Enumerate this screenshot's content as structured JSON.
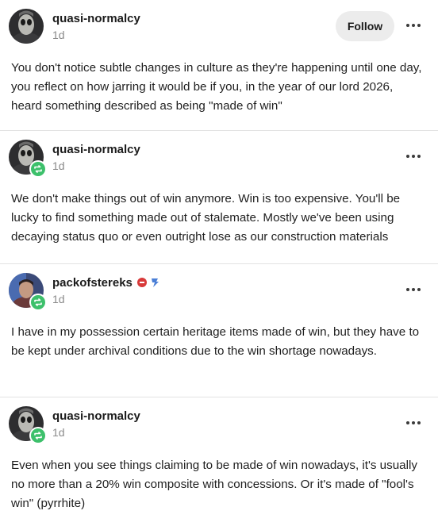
{
  "posts": [
    {
      "username": "quasi-normalcy",
      "timestamp": "1d",
      "follow_label": "Follow",
      "text": "You don't notice subtle changes in culture as they're happening until one day, you reflect on how jarring it would be if you, in the year of our lord 2026, heard something described as being \"made of win\""
    },
    {
      "username": "quasi-normalcy",
      "timestamp": "1d",
      "text": "We don't make things out of win anymore. Win is too expensive. You'll be lucky to find something made out of stalemate. Mostly we've been using decaying status quo or even outright lose as our construction materials"
    },
    {
      "username": "packofstereks",
      "timestamp": "1d",
      "text": "I have in my possession certain heritage items made of win, but they have to be kept under archival conditions due to the win shortage nowadays."
    },
    {
      "username": "quasi-normalcy",
      "timestamp": "1d",
      "text": "Even when you see things claiming to be made of win nowadays, it's usually no more than a 20% win composite with concessions. Or it's made of \"fool's win\" (pyrrhite)"
    }
  ],
  "colors": {
    "reblog_badge": "#3dc06b",
    "follow_button_bg": "#ececec",
    "timestamp": "#8a8a8a",
    "divider": "#e3e3e3"
  },
  "icons": {
    "reblog": "reblog-icon",
    "more": "more-icon"
  }
}
